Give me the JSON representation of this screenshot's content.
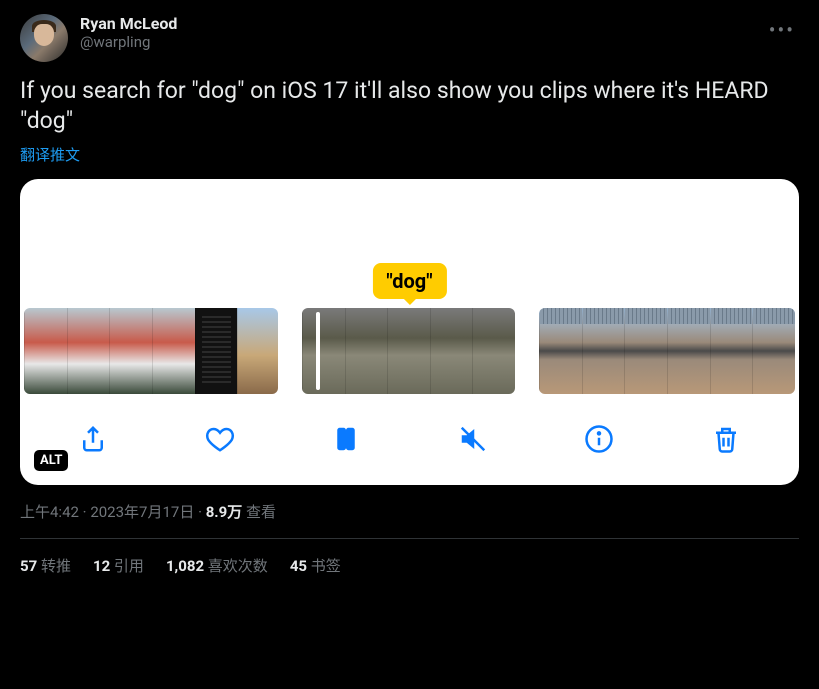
{
  "author": {
    "display_name": "Ryan McLeod",
    "handle": "@warpling"
  },
  "body": "If you search for \"dog\" on iOS 17 it'll also show you clips where it's HEARD \"dog\"",
  "translate_label": "翻译推文",
  "media": {
    "tooltip": "\"dog\"",
    "alt_badge": "ALT"
  },
  "meta": {
    "time": "上午4:42",
    "date": "2023年7月17日",
    "views_num": "8.9万",
    "views_label": "查看"
  },
  "stats": {
    "retweets_num": "57",
    "retweets_label": "转推",
    "quotes_num": "12",
    "quotes_label": "引用",
    "likes_num": "1,082",
    "likes_label": "喜欢次数",
    "bookmarks_num": "45",
    "bookmarks_label": "书签"
  }
}
